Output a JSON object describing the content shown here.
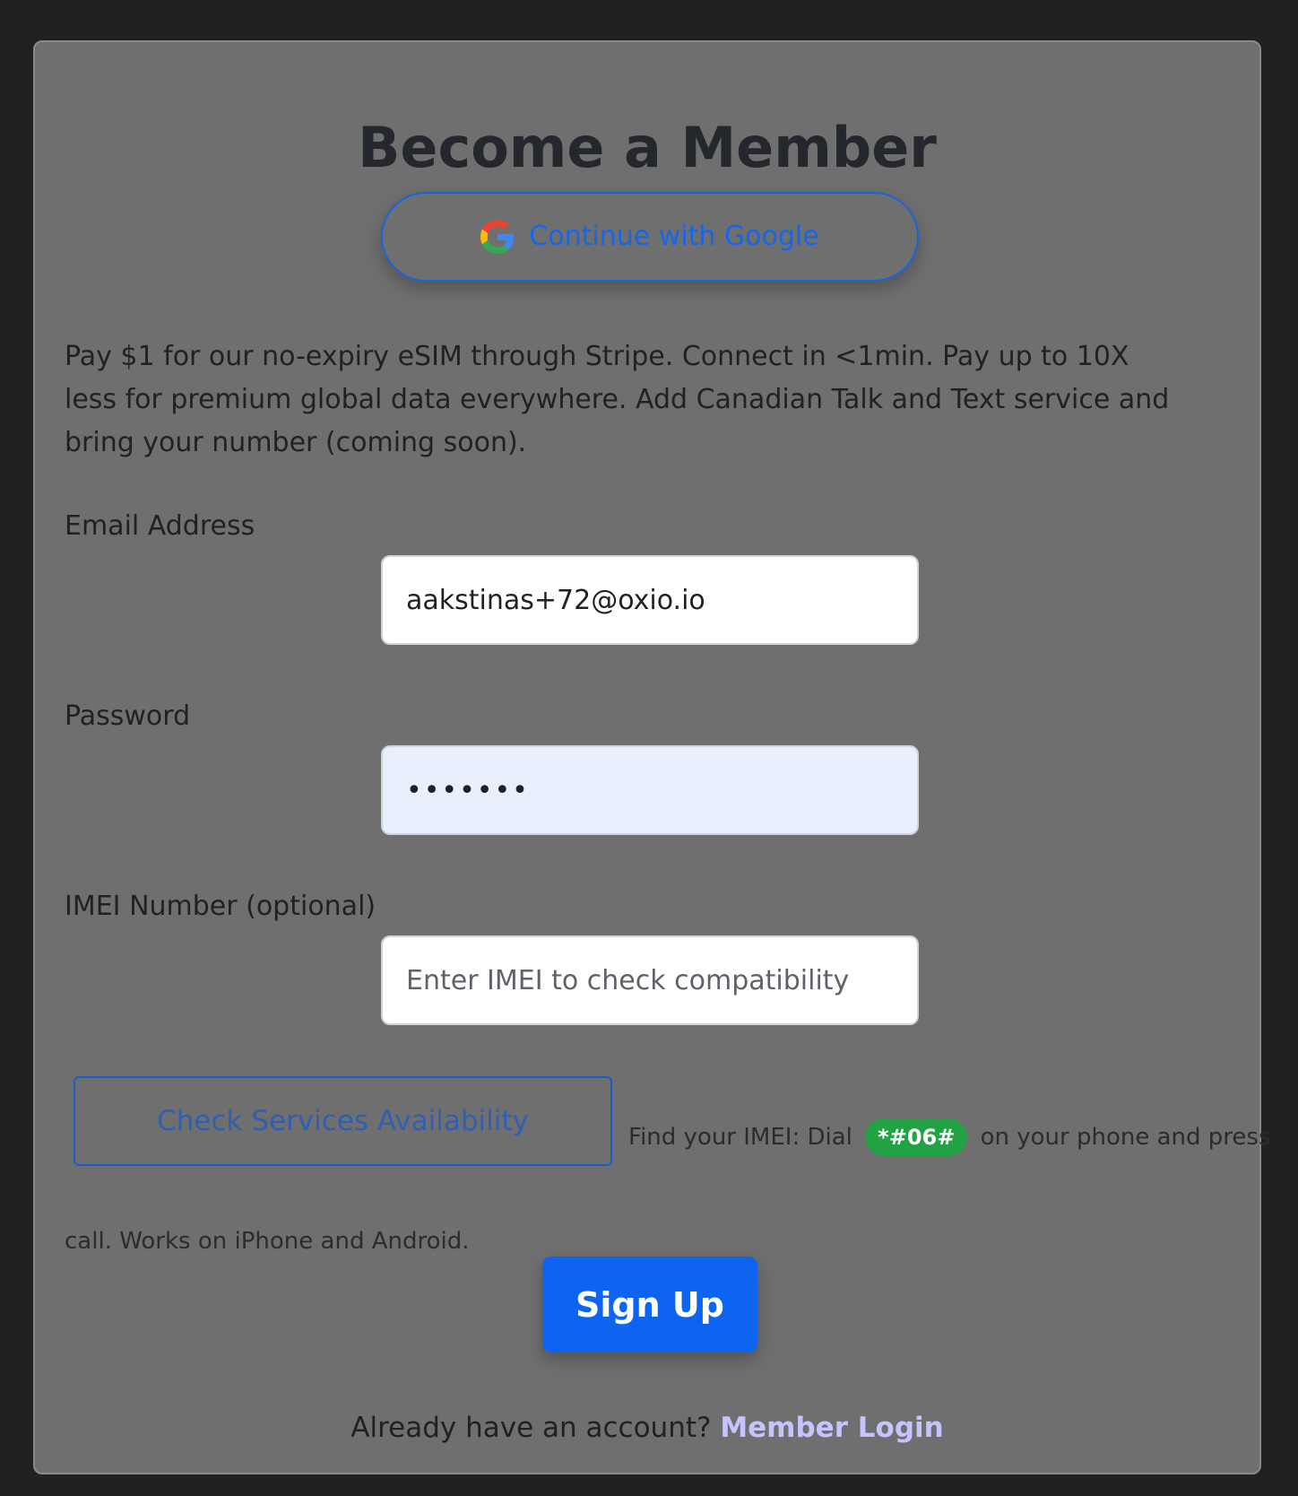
{
  "page": {
    "title": "Become a Member"
  },
  "google": {
    "label": "Continue with Google",
    "icon": "google-icon"
  },
  "description": "Pay $1 for our no-expiry eSIM through Stripe. Connect in <1min. Pay up to 10X less for premium global data everywhere. Add Canadian Talk and Text service and bring your number (coming soon).",
  "form": {
    "email": {
      "label": "Email Address",
      "value": "aakstinas+72@oxio.io"
    },
    "password": {
      "label": "Password",
      "value": "•••••••"
    },
    "imei": {
      "label": "IMEI Number (optional)",
      "placeholder": "Enter IMEI to check compatibility"
    },
    "check_button": "Check Services Availability",
    "imei_help": {
      "prefix": "Find your IMEI: Dial",
      "code": "*#06#",
      "suffix": "on your phone and press",
      "line2": "call. Works on iPhone and Android."
    },
    "submit": "Sign Up"
  },
  "footer": {
    "prompt": "Already have an account?",
    "link": "Member Login"
  },
  "colors": {
    "background": "#212121",
    "card": "#6f6f6f",
    "accent": "#0d64f0",
    "badge": "#22a244",
    "link": "#c6c3ff"
  }
}
